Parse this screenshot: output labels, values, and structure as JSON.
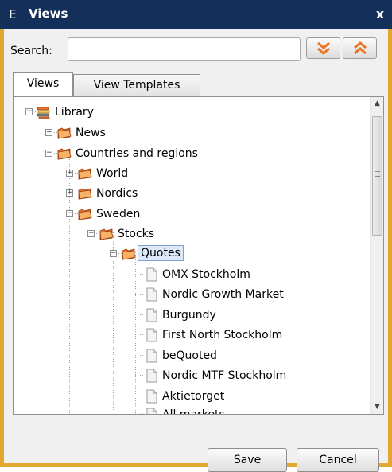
{
  "window": {
    "title": "Views",
    "app_icon_letter": "E",
    "close_glyph": "x"
  },
  "search": {
    "label": "Search:",
    "value": "",
    "placeholder": "",
    "expand_all_icon": "double-chevron-down-icon",
    "collapse_all_icon": "double-chevron-up-icon"
  },
  "tabs": [
    {
      "label": "Views",
      "active": true
    },
    {
      "label": "View Templates",
      "active": false
    }
  ],
  "tree": {
    "root": "Library",
    "items": [
      {
        "label": "News",
        "type": "folder",
        "expanded": false
      },
      {
        "label": "Countries and regions",
        "type": "folder",
        "expanded": true
      },
      {
        "label": "World",
        "type": "folder",
        "expanded": false
      },
      {
        "label": "Nordics",
        "type": "folder",
        "expanded": false
      },
      {
        "label": "Sweden",
        "type": "folder",
        "expanded": true
      },
      {
        "label": "Stocks",
        "type": "folder",
        "expanded": true
      },
      {
        "label": "Quotes",
        "type": "folder",
        "expanded": true,
        "selected": true
      },
      {
        "label": "OMX Stockholm",
        "type": "document"
      },
      {
        "label": "Nordic Growth Market",
        "type": "document"
      },
      {
        "label": "Burgundy",
        "type": "document"
      },
      {
        "label": "First North Stockholm",
        "type": "document"
      },
      {
        "label": "beQuoted",
        "type": "document"
      },
      {
        "label": "Nordic MTF Stockholm",
        "type": "document"
      },
      {
        "label": "Aktietorget",
        "type": "document"
      },
      {
        "label": "All markets",
        "type": "document"
      }
    ]
  },
  "buttons": {
    "save": "Save",
    "cancel": "Cancel"
  },
  "colors": {
    "titlebar": "#14305a",
    "window_border": "#e3a72f",
    "folder": "#e8752a",
    "arrows": "#e8752a",
    "selection": "#dde9fb"
  }
}
